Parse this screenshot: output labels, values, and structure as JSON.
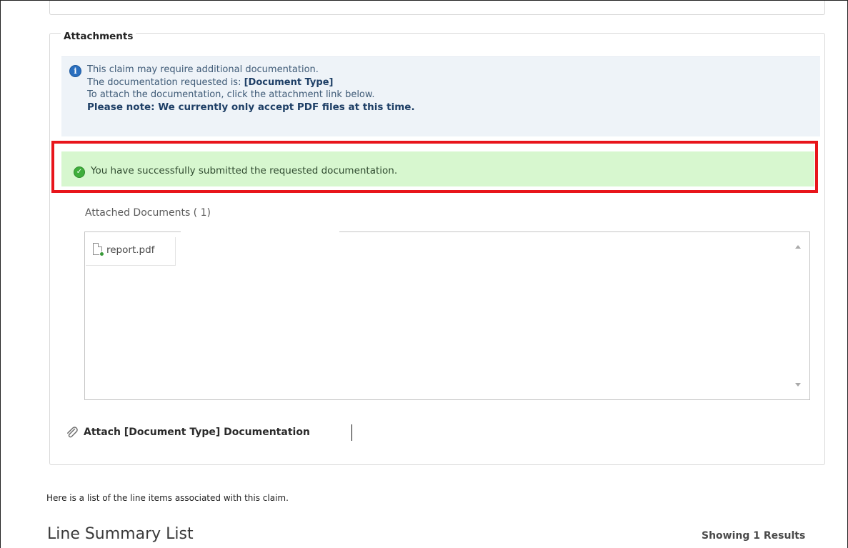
{
  "attachments": {
    "title": "Attachments",
    "info": {
      "icon": "info-icon",
      "line1": "This claim may require additional documentation.",
      "line2_prefix": "The documentation requested is:",
      "document_type": "[Document Type]",
      "line3": "To attach the documentation, click the attachment link below.",
      "note": "Please note: We currently only accept PDF files at this time."
    },
    "success": {
      "icon": "check-circle-icon",
      "message": "You have successfully submitted the requested documentation."
    },
    "attached_label": "Attached Documents ( 1)",
    "documents": [
      {
        "name": "report.pdf",
        "icon": "pdf-file-icon"
      }
    ],
    "attach_link": "Attach [Document Type] Documentation"
  },
  "intro_text": "Here is a list of the line items associated with this claim.",
  "line_summary": {
    "title": "Line Summary List",
    "results": "Showing 1 Results"
  },
  "colors": {
    "info_bg": "#eef3f8",
    "success_bg": "#d7f7cf",
    "highlight_outline": "#e8151b"
  }
}
